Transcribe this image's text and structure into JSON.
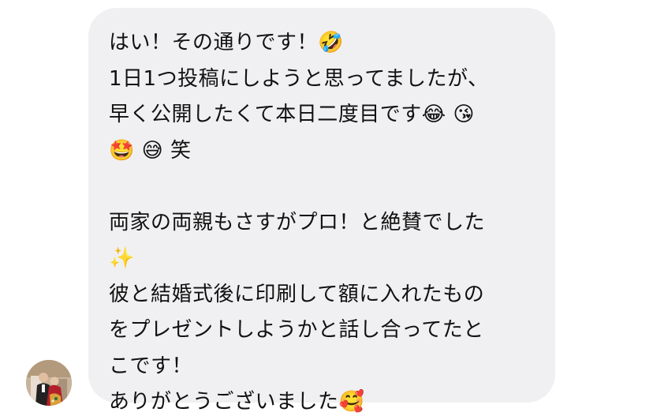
{
  "message": {
    "lines": [
      "はい！その通りです！🤣",
      "1日1つ投稿にしようと思ってましたが、",
      "早く公開したくて本日二度目です😂 😘",
      "🤩 😅 笑",
      "",
      "両家の両親もさすがプロ！と絶賛でした",
      "✨",
      "彼と結婚式後に印刷して額に入れたもの",
      "をプレゼントしようかと話し合ってたと",
      "こです！",
      "ありがとうございました🥰"
    ]
  },
  "colors": {
    "bubble_background": "#f0f0f2",
    "text": "#111111",
    "page_background": "#ffffff"
  },
  "avatar": {
    "icon": "sender-avatar-photo"
  }
}
